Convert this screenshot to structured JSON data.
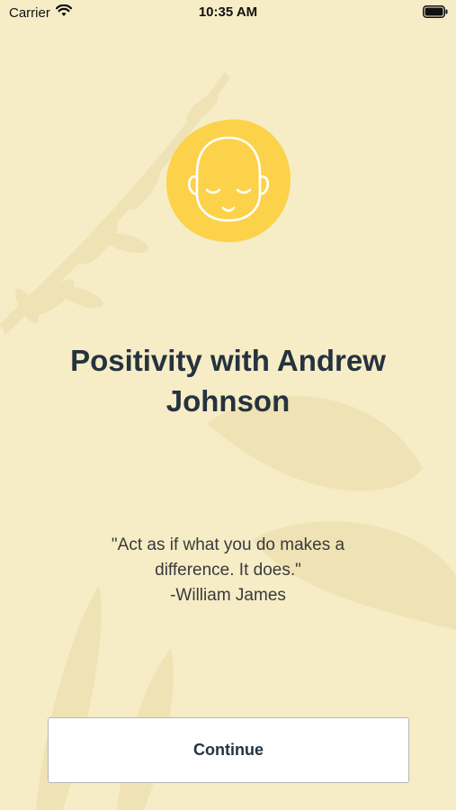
{
  "status_bar": {
    "carrier": "Carrier",
    "time": "10:35 AM"
  },
  "main": {
    "title": "Positivity with Andrew Johnson",
    "quote": "\"Act as if what you do makes a\ndifference. It does.\"",
    "author": "-William James"
  },
  "footer": {
    "continue_label": "Continue"
  },
  "colors": {
    "background": "#f6ecc6",
    "avatar_blob": "#fcd24a",
    "title": "#25333f"
  },
  "icons": [
    "wifi-icon",
    "battery-icon",
    "meditating-face-icon"
  ]
}
